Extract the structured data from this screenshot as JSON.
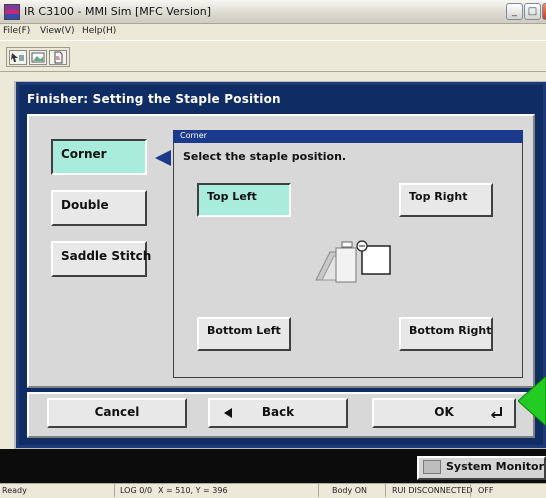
{
  "window": {
    "title": "IR C3100 - MMI Sim [MFC Version]",
    "min_glyph": "_",
    "max_glyph": "□"
  },
  "menu": {
    "items": [
      "File(F)",
      "View(V)",
      "Help(H)"
    ]
  },
  "toolbar": {
    "buttons": [
      "select-icon",
      "image-icon",
      "document-icon"
    ]
  },
  "screen": {
    "title": "Finisher: Setting the Staple Position",
    "tabs": [
      {
        "label": "Corner",
        "selected": true
      },
      {
        "label": "Double",
        "selected": false
      },
      {
        "label": "Saddle Stitch",
        "selected": false
      }
    ],
    "subpanel": {
      "header": "Corner",
      "instruction": "Select the staple position.",
      "positions": [
        {
          "label": "Top Left",
          "selected": true
        },
        {
          "label": "Top Right",
          "selected": false
        },
        {
          "label": "Bottom Left",
          "selected": false
        },
        {
          "label": "Bottom Right",
          "selected": false
        }
      ]
    },
    "actions": {
      "cancel": "Cancel",
      "back": "Back",
      "ok": "OK"
    }
  },
  "system_monitor": {
    "label": "System Monitor"
  },
  "status": {
    "ready": "Ready",
    "log": "LOG 0/0",
    "coords": "X = 510, Y = 396",
    "body": "Body ON",
    "rui": "RUI DISCONNECTED",
    "off": "OFF"
  },
  "colors": {
    "screen_bg": "#0f2d63",
    "selected": "#a8ecdc",
    "header_blue": "#1c3a8c",
    "pointer_green": "#22cc22"
  }
}
